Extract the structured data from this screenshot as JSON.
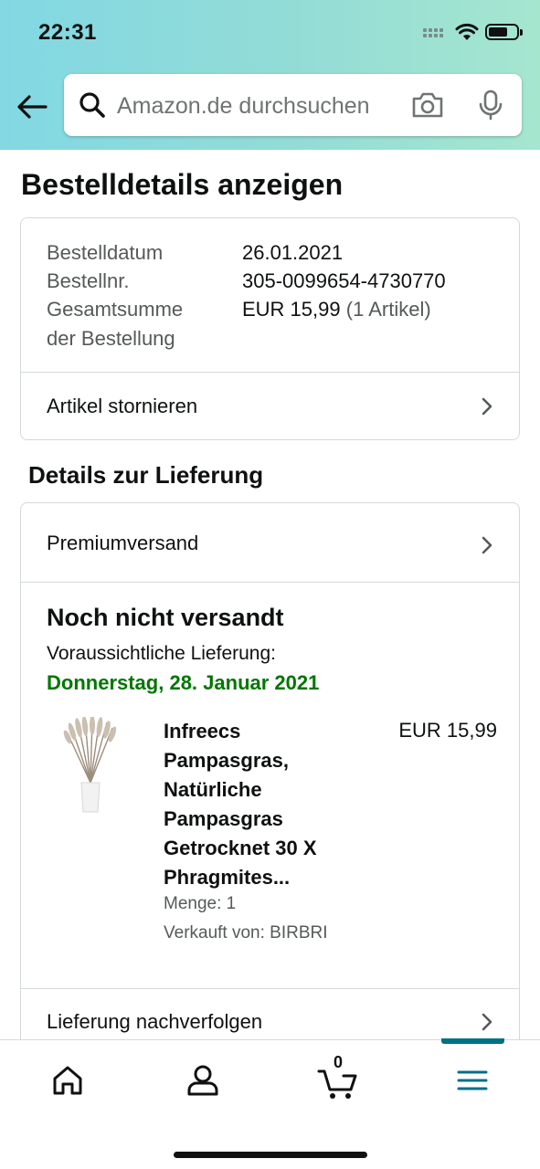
{
  "status_bar": {
    "time": "22:31"
  },
  "header": {
    "search_placeholder": "Amazon.de durchsuchen",
    "icons": [
      "back-arrow-icon",
      "search-icon",
      "camera-icon",
      "microphone-icon"
    ]
  },
  "page": {
    "title": "Bestelldetails anzeigen"
  },
  "order": {
    "date_label": "Bestelldatum",
    "date_value": "26.01.2021",
    "number_label": "Bestellnr.",
    "number_value": "305-0099654-4730770",
    "total_label_line1": "Gesamtsumme",
    "total_label_line2": "der Bestellung",
    "total_value": "EUR 15,99",
    "total_count": "(1 Artikel)",
    "cancel_label": "Artikel stornieren"
  },
  "delivery": {
    "section_title": "Details zur Lieferung",
    "shipping_method": "Premiumversand",
    "status": "Noch nicht versandt",
    "eta_label": "Voraussichtliche Lieferung:",
    "eta_date": "Donnerstag, 28. Januar 2021",
    "eta_color": "#007600",
    "item": {
      "title_lines": [
        "Infreecs",
        "Pampasgras,",
        "Natürliche",
        "Pampasgras",
        "Getrocknet 30 X",
        "Phragmites..."
      ],
      "price": "EUR 15,99",
      "quantity": "Menge: 1",
      "seller": "Verkauft von: BIRBRI"
    },
    "track_label": "Lieferung nachverfolgen"
  },
  "tabbar": {
    "cart_count": "0",
    "active_tab": "menu",
    "accent_color": "#007185",
    "icons": [
      "home-icon",
      "account-icon",
      "cart-icon",
      "menu-icon"
    ]
  }
}
